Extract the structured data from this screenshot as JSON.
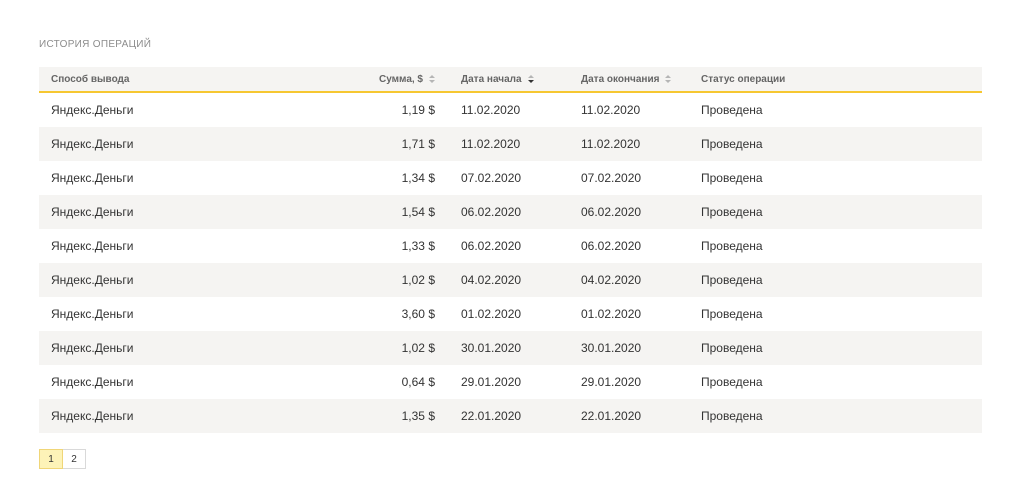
{
  "section": {
    "title": "ИСТОРИЯ ОПЕРАЦИЙ"
  },
  "table": {
    "headers": {
      "method": "Способ вывода",
      "amount": "Сумма, $",
      "start_date": "Дата начала",
      "end_date": "Дата окончания",
      "status": "Статус операции"
    },
    "sorted_by": "start_date",
    "rows": [
      {
        "method": "Яндекс.Деньги",
        "amount": "1,19 $",
        "start": "11.02.2020",
        "end": "11.02.2020",
        "status": "Проведена"
      },
      {
        "method": "Яндекс.Деньги",
        "amount": "1,71 $",
        "start": "11.02.2020",
        "end": "11.02.2020",
        "status": "Проведена"
      },
      {
        "method": "Яндекс.Деньги",
        "amount": "1,34 $",
        "start": "07.02.2020",
        "end": "07.02.2020",
        "status": "Проведена"
      },
      {
        "method": "Яндекс.Деньги",
        "amount": "1,54 $",
        "start": "06.02.2020",
        "end": "06.02.2020",
        "status": "Проведена"
      },
      {
        "method": "Яндекс.Деньги",
        "amount": "1,33 $",
        "start": "06.02.2020",
        "end": "06.02.2020",
        "status": "Проведена"
      },
      {
        "method": "Яндекс.Деньги",
        "amount": "1,02 $",
        "start": "04.02.2020",
        "end": "04.02.2020",
        "status": "Проведена"
      },
      {
        "method": "Яндекс.Деньги",
        "amount": "3,60 $",
        "start": "01.02.2020",
        "end": "01.02.2020",
        "status": "Проведена"
      },
      {
        "method": "Яндекс.Деньги",
        "amount": "1,02 $",
        "start": "30.01.2020",
        "end": "30.01.2020",
        "status": "Проведена"
      },
      {
        "method": "Яндекс.Деньги",
        "amount": "0,64 $",
        "start": "29.01.2020",
        "end": "29.01.2020",
        "status": "Проведена"
      },
      {
        "method": "Яндекс.Деньги",
        "amount": "1,35 $",
        "start": "22.01.2020",
        "end": "22.01.2020",
        "status": "Проведена"
      }
    ]
  },
  "pagination": {
    "pages": [
      "1",
      "2"
    ],
    "current": "1"
  },
  "colors": {
    "accent": "#f6c731",
    "stripe": "#f5f4f2",
    "active_page": "#fdf3b8"
  }
}
